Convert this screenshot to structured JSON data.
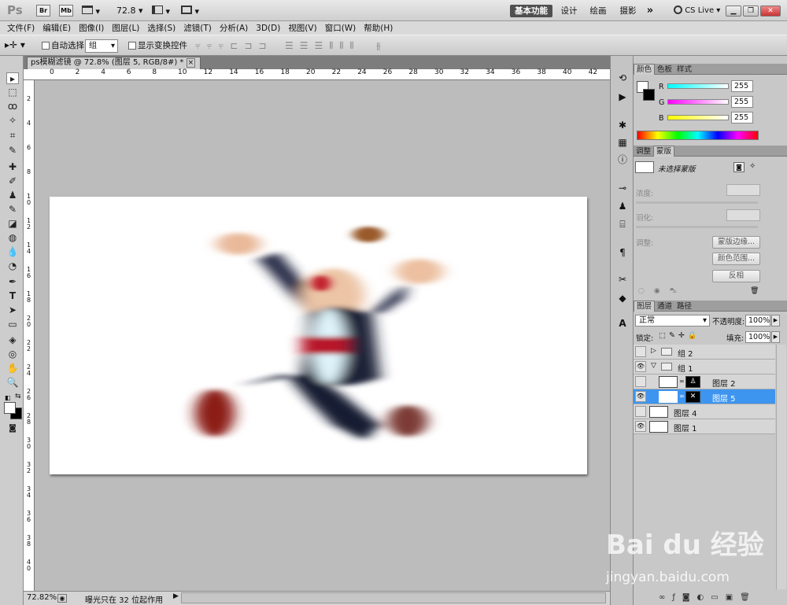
{
  "app": {
    "logo": "Ps",
    "br": "Br",
    "mb": "Mb",
    "zoom": "72.8",
    "workspaces": [
      "基本功能",
      "设计",
      "绘画",
      "摄影"
    ],
    "more": "»",
    "cslive": "CS Live"
  },
  "menu": [
    "文件(F)",
    "编辑(E)",
    "图像(I)",
    "图层(L)",
    "选择(S)",
    "滤镜(T)",
    "分析(A)",
    "3D(D)",
    "视图(V)",
    "窗口(W)",
    "帮助(H)"
  ],
  "options": {
    "auto_select_label": "自动选择:",
    "auto_select_value": "组",
    "show_transform_label": "显示变换控件"
  },
  "document": {
    "tab_title": "ps模糊滤镜 @ 72.8% (图层 5, RGB/8#) *",
    "close": "×"
  },
  "ruler": {
    "h": [
      "0",
      "2",
      "4",
      "6",
      "8",
      "10",
      "12",
      "14",
      "16",
      "18",
      "20",
      "22",
      "24",
      "26",
      "28",
      "30",
      "32",
      "34",
      "36",
      "38",
      "40",
      "42"
    ],
    "v": [
      "2",
      "4",
      "6",
      "8",
      "10",
      "12",
      "14",
      "16",
      "18",
      "20",
      "22",
      "24",
      "26",
      "28",
      "30",
      "32",
      "34",
      "36",
      "38",
      "40"
    ]
  },
  "status": {
    "zoom": "72.82%",
    "info": "曝光只在 32 位起作用"
  },
  "color_panel": {
    "tabs": [
      "颜色",
      "色板",
      "样式"
    ],
    "r_label": "R",
    "g_label": "G",
    "b_label": "B",
    "r": "255",
    "g": "255",
    "b": "255"
  },
  "mask_panel": {
    "tabs": [
      "调整",
      "蒙版"
    ],
    "title": "未选择蒙版",
    "density": "浓度:",
    "feather": "羽化:",
    "refine": "调整:",
    "edge_btn": "蒙版边缘...",
    "color_range_btn": "颜色范围...",
    "invert_btn": "反相"
  },
  "layers_panel": {
    "tabs": [
      "图层",
      "通道",
      "路径"
    ],
    "blend_mode": "正常",
    "opacity_label": "不透明度:",
    "opacity": "100%",
    "lock_label": "锁定:",
    "fill_label": "填充:",
    "fill": "100%",
    "layers": [
      {
        "name": "组 2",
        "visible": false
      },
      {
        "name": "组 1",
        "visible": true
      },
      {
        "name": "图层 2",
        "visible": false
      },
      {
        "name": "图层 5",
        "visible": true
      },
      {
        "name": "图层 4",
        "visible": false
      },
      {
        "name": "图层 1",
        "visible": true
      }
    ]
  },
  "watermark": {
    "brand": "Bai du 经验",
    "url": "jingyan.baidu.com"
  },
  "colors": {
    "accent": "#3d95f0",
    "workspace_active": "#505050"
  }
}
